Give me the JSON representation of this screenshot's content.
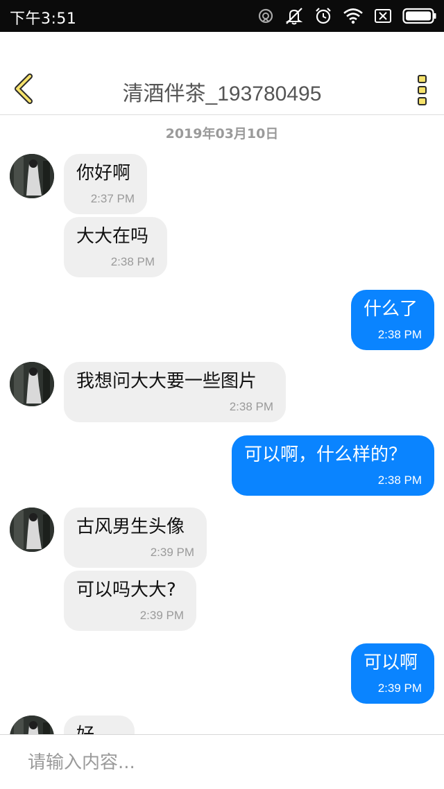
{
  "status_bar": {
    "time": "下午3:51",
    "icons": [
      "sync-icon",
      "mute-icon",
      "alarm-icon",
      "wifi-icon",
      "sim-off-icon",
      "battery-icon"
    ]
  },
  "header": {
    "back_icon": "chevron-left-icon",
    "title": "清酒伴茶_193780495",
    "more_icon": "more-vertical-icon"
  },
  "chat": {
    "date": "2019年03月10日",
    "messages": [
      {
        "dir": "in",
        "text": "你好啊",
        "time": "2:37 PM"
      },
      {
        "dir": "in",
        "text": "大大在吗",
        "time": "2:38 PM"
      },
      {
        "dir": "out",
        "text": "什么了",
        "time": "2:38 PM"
      },
      {
        "dir": "in",
        "text": "我想问大大要一些图片",
        "time": "2:38 PM"
      },
      {
        "dir": "out",
        "text": "可以啊，什么样的？",
        "time": "2:38 PM"
      },
      {
        "dir": "in",
        "text": "古风男生头像",
        "time": "2:39 PM"
      },
      {
        "dir": "in",
        "text": "可以吗大大?",
        "time": "2:39 PM"
      },
      {
        "dir": "out",
        "text": "可以啊",
        "time": "2:39 PM"
      },
      {
        "dir": "in",
        "text": "好",
        "time": ""
      }
    ]
  },
  "input": {
    "placeholder": "请输入内容..."
  },
  "colors": {
    "outgoing_bubble": "#0a84ff",
    "incoming_bubble": "#efefef",
    "accent_yellow": "#f6e26b"
  }
}
